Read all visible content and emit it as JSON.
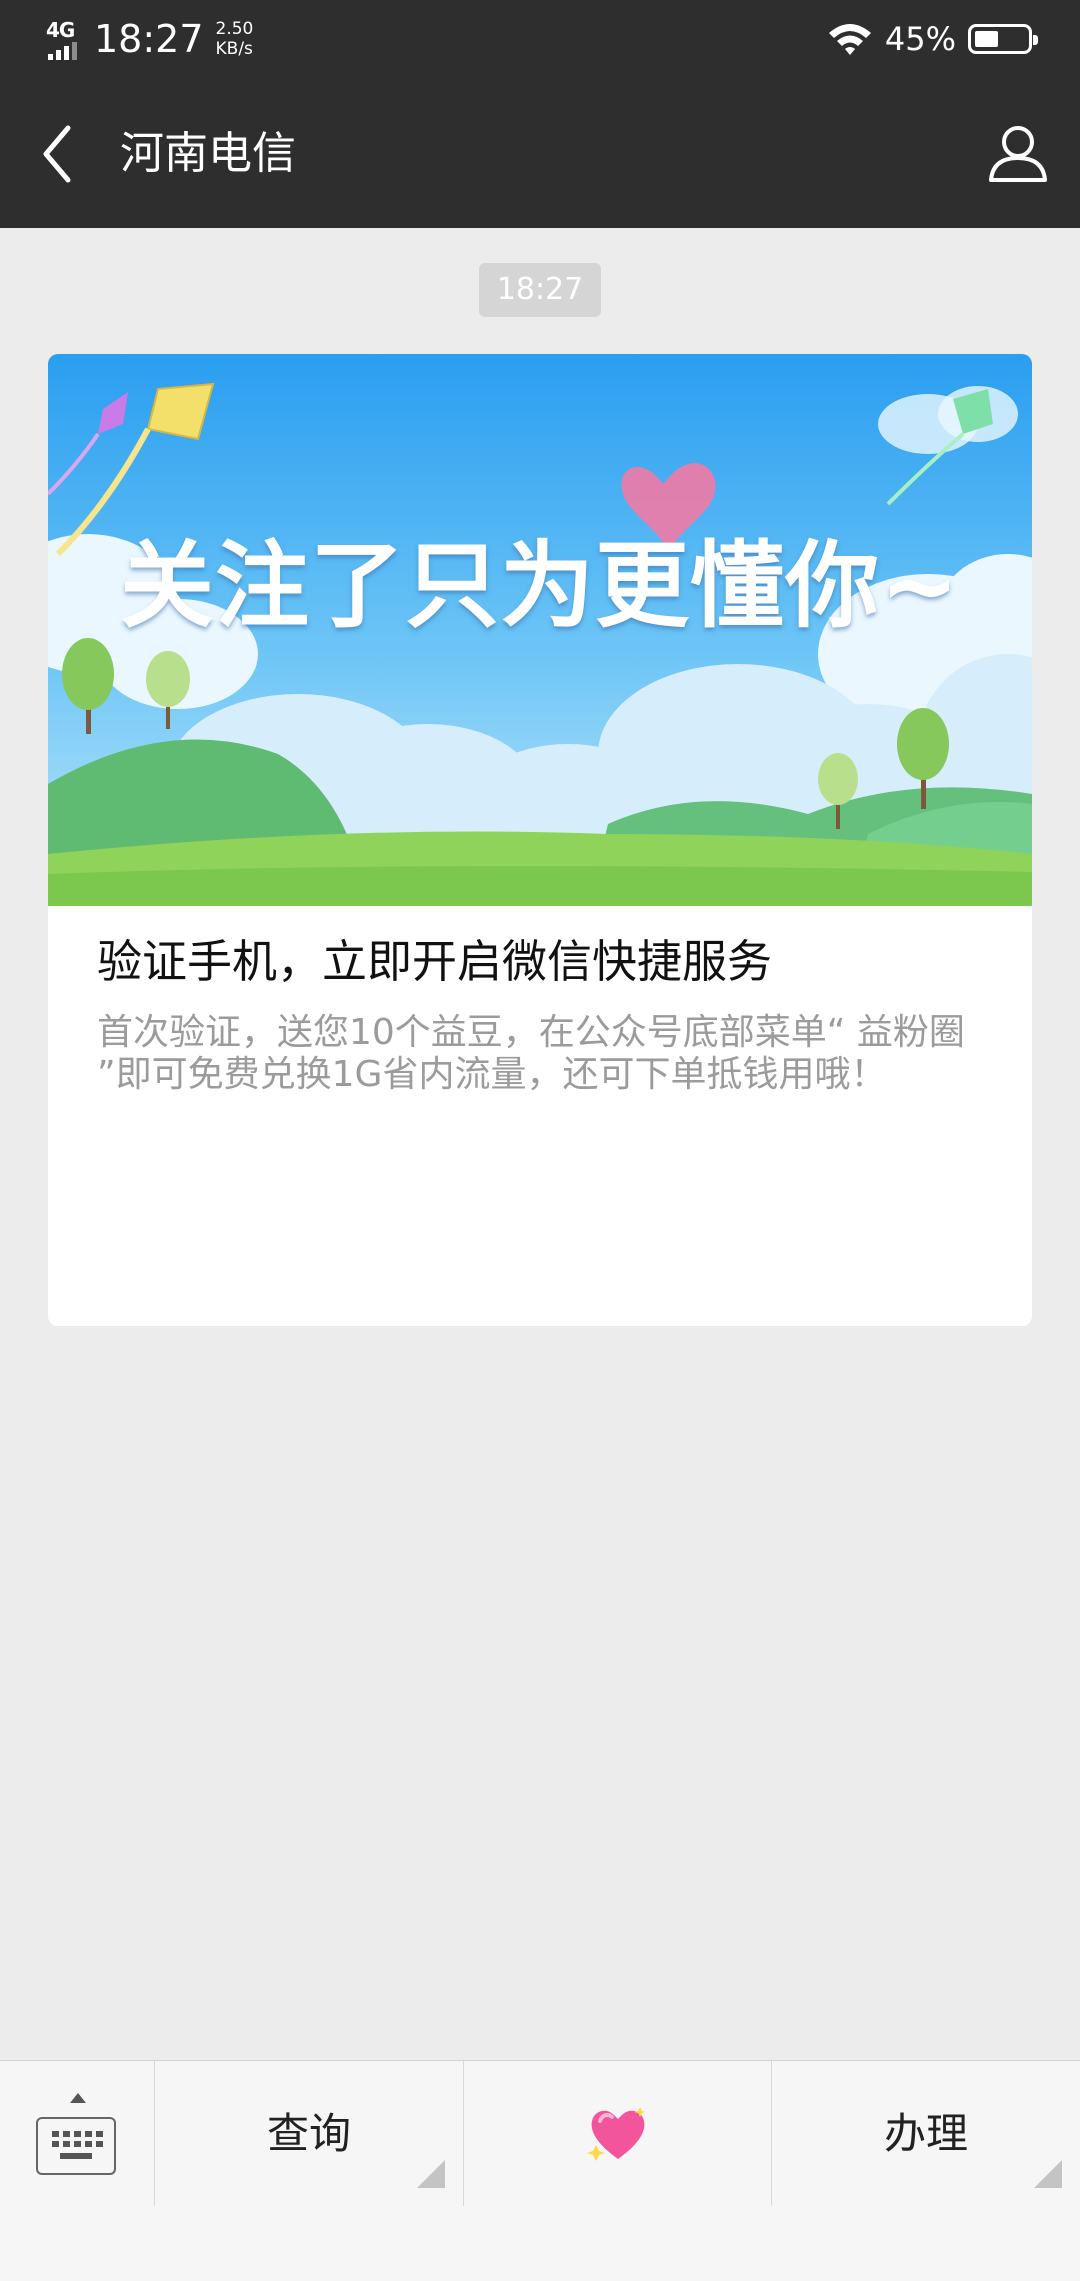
{
  "status_bar": {
    "network": "4G",
    "time": "18:27",
    "speed_value": "2.50",
    "speed_unit": "KB/s",
    "battery_percent": "45%",
    "battery_level": 0.45
  },
  "header": {
    "title": "河南电信",
    "back_icon": "chevron-left-icon",
    "profile_icon": "user-profile-icon"
  },
  "chat": {
    "timestamp": "18:27",
    "card": {
      "banner_text": "关注了只为更懂你~",
      "title": "验证手机，立即开启微信快捷服务",
      "description": "首次验证，送您10个益豆，在公众号底部菜单“ 益粉圈 ”即可免费兑换1G省内流量，还可下单抵钱用哦！"
    }
  },
  "bottom_menu": {
    "keyboard_icon": "keyboard-icon",
    "items": [
      {
        "label": "查询"
      },
      {
        "icon": "sparkling-heart-icon"
      },
      {
        "label": "办理"
      }
    ]
  },
  "colors": {
    "bar_background": "#2e2e2e",
    "chat_background": "#ececec",
    "description_gray": "#9b9b9b"
  }
}
